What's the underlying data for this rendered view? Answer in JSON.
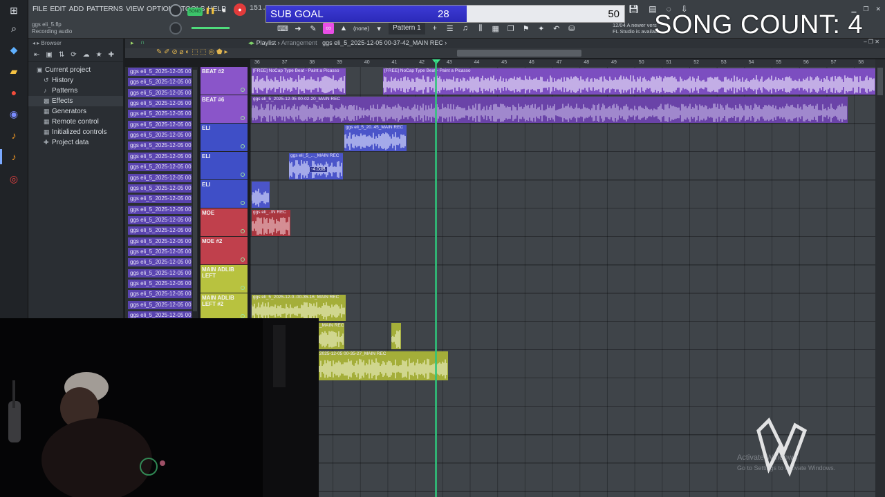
{
  "fl": {
    "menus": [
      "FILE",
      "EDIT",
      "ADD",
      "PATTERNS",
      "VIEW",
      "OPTIONS",
      "TOOLS",
      "HELP"
    ],
    "project_hint": "ggs eli_5.flp",
    "status_hint": "Recording audio",
    "song_mode": "SONG",
    "tempo": "151.0",
    "pattern": "Pattern 1",
    "none_label": "(none)",
    "news_date": "12/04",
    "news_text_1": "A newer vers",
    "news_text_2": "FL Studio is availab"
  },
  "overlay": {
    "goal_label": "SUB GOAL",
    "goal_current": "28",
    "goal_max": "50",
    "goal_progress": 0.56,
    "song_count": "SONG COUNT: 4"
  },
  "browser": {
    "title": "Browser",
    "items": [
      {
        "label": "Current project",
        "icon": "folder-icon"
      },
      {
        "label": "History",
        "icon": "history-icon"
      },
      {
        "label": "Patterns",
        "icon": "note-icon"
      },
      {
        "label": "Effects",
        "icon": "effects-icon"
      },
      {
        "label": "Generators",
        "icon": "generators-icon"
      },
      {
        "label": "Remote control",
        "icon": "remote-icon"
      },
      {
        "label": "Initialized controls",
        "icon": "controls-icon"
      },
      {
        "label": "Project data",
        "icon": "data-icon"
      }
    ]
  },
  "playlist": {
    "title": "Playlist",
    "section": "Arrangement",
    "file": "ggs eli_5_2025-12-05 00-37-42_MAIN REC",
    "ruler": [
      "36",
      "37",
      "38",
      "39",
      "40",
      "41",
      "42",
      "43",
      "44",
      "45",
      "46",
      "47",
      "48",
      "49",
      "50",
      "51",
      "52",
      "53",
      "54",
      "55",
      "56",
      "57",
      "58"
    ],
    "clip_names": [
      "ggs eli_5_2025-12-05 00",
      "ggs eli_5_2025-12-05 00",
      "ggs eli_5_2025-12-05 00",
      "ggs eli_5_2025-12-05 00",
      "ggs eli_5_2025-12-05 00",
      "ggs eli_5_2025-12-05 00",
      "ggs eli_5_2025-12-05 00",
      "ggs eli_5_2025-12-05 00",
      "ggs eli_5_2025-12-05 00",
      "ggs eli_5_2025-12-05 00",
      "ggs eli_5_2025-12-05 00",
      "ggs eli_5_2025-12-05 00",
      "ggs eli_5_2025-12-05 00",
      "ggs eli_5_2025-12-05 00",
      "ggs eli_5_2025-12-05 00",
      "ggs eli_5_2025-12-05 00",
      "ggs eli_5_2025-12-05 00",
      "ggs eli_5_2025-12-05 00",
      "ggs eli_5_2025-12-05 00",
      "ggs eli_5_2025-12-05 00",
      "ggs eli_5_2025-12-05 00",
      "ggs eli_5_2025-12-05 00",
      "ggs eli_5_2025-12-05 00",
      "ggs eli_5_2025-12-05 00"
    ],
    "tracks": [
      {
        "name": "BEAT #2",
        "color": "#8a55c9"
      },
      {
        "name": "BEAT #6",
        "color": "#8a55c9"
      },
      {
        "name": "ELI",
        "color": "#3f4fc7"
      },
      {
        "name": "ELI",
        "color": "#3f4fc7"
      },
      {
        "name": "ELI",
        "color": "#3f4fc7"
      },
      {
        "name": "MOE",
        "color": "#c0404c"
      },
      {
        "name": "MOE #2",
        "color": "#c0404c"
      },
      {
        "name": "MAIN ADLIB LEFT",
        "color": "#b8c23f"
      },
      {
        "name": "MAIN ADLIB LEFT #2",
        "color": "#b8c23f"
      }
    ],
    "clips": {
      "beat2_a": "[FREE] NoCap Type Beat - Paint a Picasso",
      "beat2_b": "[FREE] NoCap Type Beat - Paint a Picasso",
      "beat6": "ggs eli_5_2025-12-05 00-02-20_MAIN REC",
      "eli1": "ggs eli_5_20..45_MAIN REC",
      "eli2": "ggs eli_5_..._MAIN REC",
      "eli2_gain": "-4.0dB",
      "moe": "ggs eli_..IN REC",
      "adlib2": "ggs eli_5_2025-12-0..00-35-16_MAIN REC",
      "row9": "_MAIN REC",
      "row10": "2025-12-05 00-35-27_MAIN REC"
    }
  },
  "os": {
    "activate_title": "Activate Windows",
    "activate_sub": "Go to Settings to activate Windows."
  },
  "colors": {
    "accent": "#3d3bd6",
    "playhead": "#2fc47a",
    "beat": "#8a55c9",
    "eli": "#3f4fc7",
    "moe": "#c0404c",
    "adlib": "#b8c23f"
  }
}
